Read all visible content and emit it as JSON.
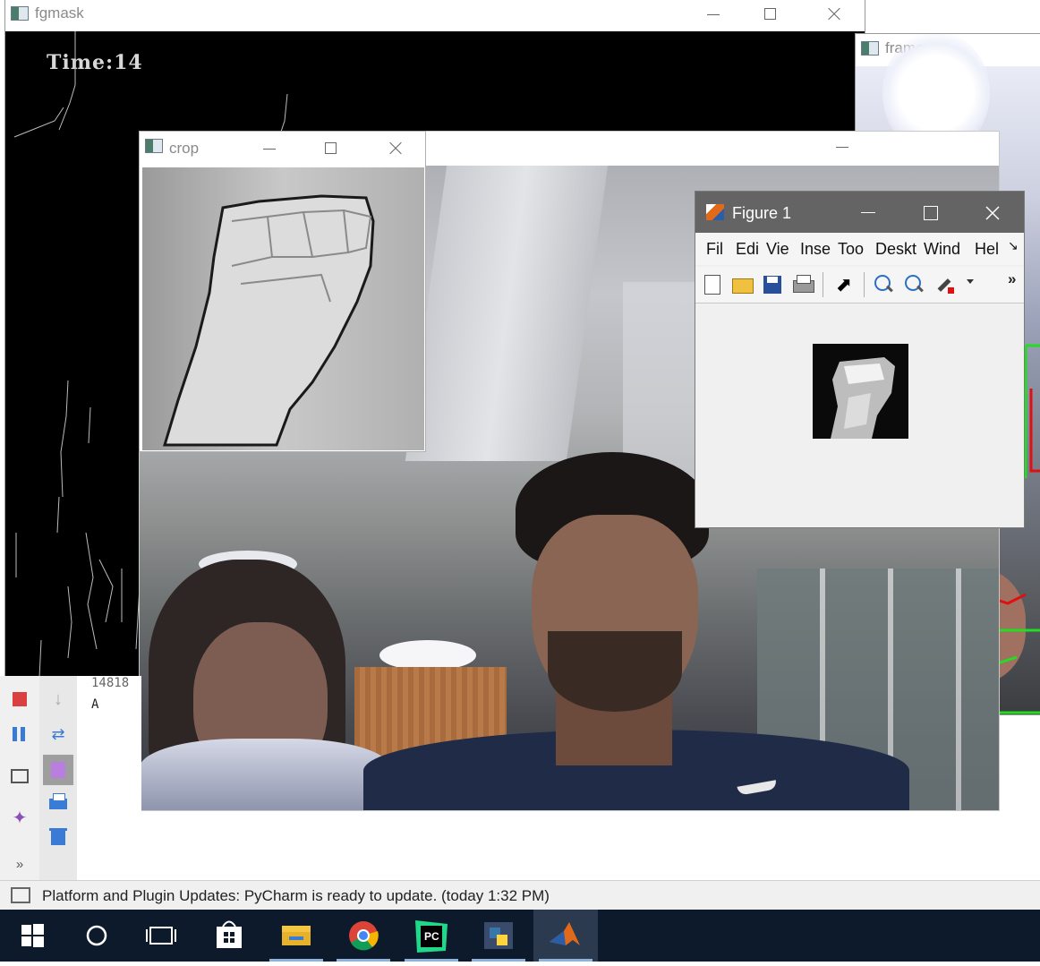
{
  "windows": {
    "fgmask": {
      "title": "fgmask",
      "overlay": "Time:14"
    },
    "frame": {
      "title": "frame"
    },
    "crop": {
      "title": "crop"
    },
    "figure": {
      "title": "Figure 1",
      "menu": [
        "Fil",
        "Edi",
        "Vie",
        "Inse",
        "Too",
        "Deskt",
        "Wind",
        "Hel"
      ],
      "overflow": "»"
    }
  },
  "console": {
    "lines": [
      "14818",
      "A"
    ]
  },
  "status": {
    "text": "Platform and Plugin Updates: PyCharm is ready to update. (today 1:32 PM)"
  },
  "sidebar": {
    "more": "»"
  },
  "taskbar": {
    "items": [
      "start",
      "search",
      "task-view",
      "store",
      "file-explorer",
      "chrome",
      "pycharm",
      "python",
      "matlab"
    ],
    "active": "matlab"
  },
  "colors": {
    "taskbar": "#0d1a2b",
    "detect_green": "#22dd22",
    "detect_red": "#e01010"
  }
}
